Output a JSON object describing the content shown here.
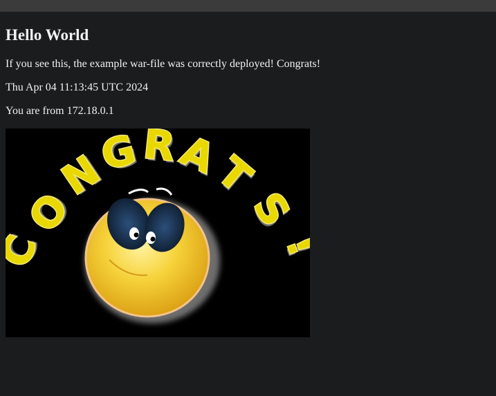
{
  "page": {
    "heading": "Hello World",
    "message": "If you see this, the example war-file was correctly deployed! Congrats!",
    "datetime": "Thu Apr 04 11:13:45 UTC 2024",
    "client": "You are from 172.18.0.1"
  },
  "image": {
    "lettering": [
      "C",
      "O",
      "N",
      "G",
      "R",
      "A",
      "T",
      "S",
      "!"
    ],
    "colors": {
      "letter": "#e8d800",
      "outline": "#f4e87a",
      "shadow": "#9a9a9a",
      "face": "#f0c020"
    }
  }
}
